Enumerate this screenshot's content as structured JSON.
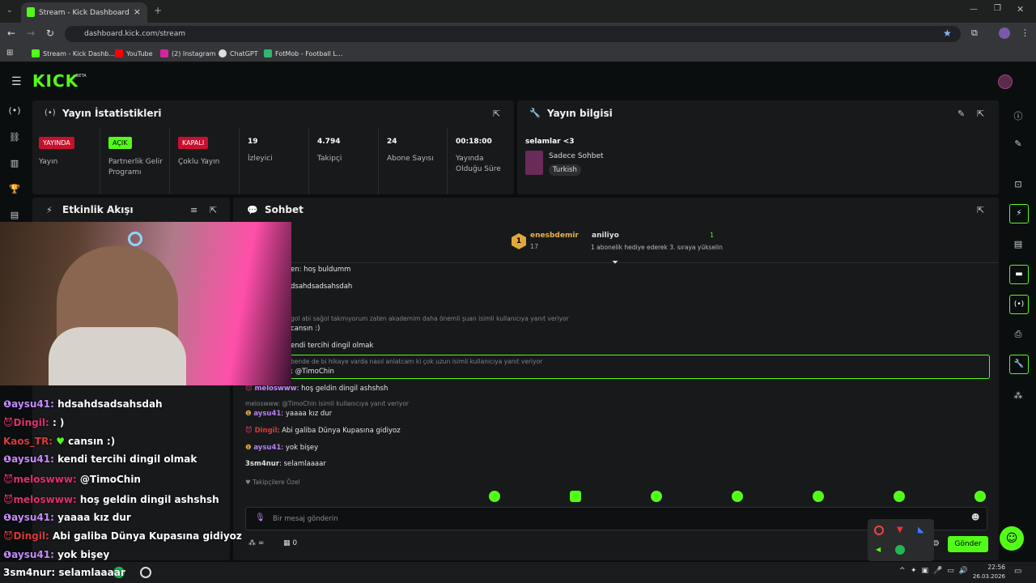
{
  "browser": {
    "tab_title": "Stream - Kick Dashboard",
    "url": "dashboard.kick.com/stream",
    "bookmarks": [
      "Stream - Kick Dashb...",
      "YouTube",
      "(2) Instagram",
      "ChatGPT",
      "FotMob - Football L..."
    ]
  },
  "kick": {
    "logo": "KICK",
    "beta": "BETA"
  },
  "stats": {
    "title": "Yayın İstatistikleri",
    "items": [
      {
        "badge": "YAYINDA",
        "label": "Yayın"
      },
      {
        "badge": "AÇIK",
        "label": "Partnerlik Gelir Programı"
      },
      {
        "badge": "KAPALI",
        "label": "Çoklu Yayın"
      },
      {
        "value": "19",
        "label": "İzleyici"
      },
      {
        "value": "4.794",
        "label": "Takipçi"
      },
      {
        "value": "24",
        "label": "Abone Sayısı"
      },
      {
        "value": "00:18:00",
        "label": "Yayında Olduğu Süre"
      }
    ]
  },
  "info": {
    "title": "Yayın bilgisi",
    "stream_title": "selamlar <3",
    "category": "Sadece Sohbet",
    "language": "Turkish"
  },
  "activity": {
    "title": "Etkinlik Akışı"
  },
  "chat": {
    "title": "Sohbet",
    "pinned": {
      "user": "enesbdemir",
      "rank": "17",
      "user2": "aniliyo",
      "count": "1",
      "text": "1 abonelik hediye ederek 3. sıraya yükselin"
    },
    "lines": [
      {
        "t": "en: hoş buldumm"
      },
      {
        "t": "dsahdsadsahsdah"
      },
      {
        "sub": "gol abi sağol takmıyorum zaten akademim daha önemli şuan isimli kullanıcıya yanıt veriyor"
      },
      {
        "t": "cansın :)"
      },
      {
        "t": "endi tercihi dingil olmak"
      },
      {
        "sub": "bende de bi hikaye varda nasıl anlatcam ki çok uzun isimli kullanıcıya yanıt veriyor"
      },
      {
        "t": ": @TimoChin"
      },
      {
        "user": "meloswww",
        "t": "hoş geldin dingil ashshsh"
      },
      {
        "sub": "meloswww: @TimoChin isimli kullanıcıya yanıt veriyor"
      },
      {
        "user": "aysu41",
        "t": "yaaaa kız dur"
      },
      {
        "user": "Dingil",
        "t": "Abi galiba Dünya Kupasına gidiyoz"
      },
      {
        "user": "aysu41",
        "t": "yok bişey"
      },
      {
        "user": "3sm4nur",
        "t": "selamlaaaar"
      }
    ],
    "followers_only": "Takipçilere Özel",
    "placeholder": "Bir mesaj gönderin",
    "send": "Gönder",
    "points": "∞",
    "zero": "0"
  },
  "overlay": [
    {
      "u": "aysu41",
      "t": "hdsahdsadsahsdah"
    },
    {
      "u": "Dingil",
      "t": ": )"
    },
    {
      "u": "Kaos_TR",
      "t": "cansın :)"
    },
    {
      "u": "aysu41",
      "t": "kendi tercihi dingil olmak"
    },
    {
      "u": "meloswww",
      "t": "@TimoChin"
    },
    {
      "u": "meloswww",
      "t": "hoş geldin dingil ashshsh"
    },
    {
      "u": "aysu41",
      "t": "yaaaa kız dur"
    },
    {
      "u": "Dingil",
      "t": "Abi galiba Dünya Kupasına gidiyoz"
    },
    {
      "u": "aysu41",
      "t": "yok bişey"
    },
    {
      "u": "3sm4nur",
      "t": "selamlaaaar"
    }
  ],
  "taskbar": {
    "time": "22:56",
    "date": "26.03.2026"
  }
}
